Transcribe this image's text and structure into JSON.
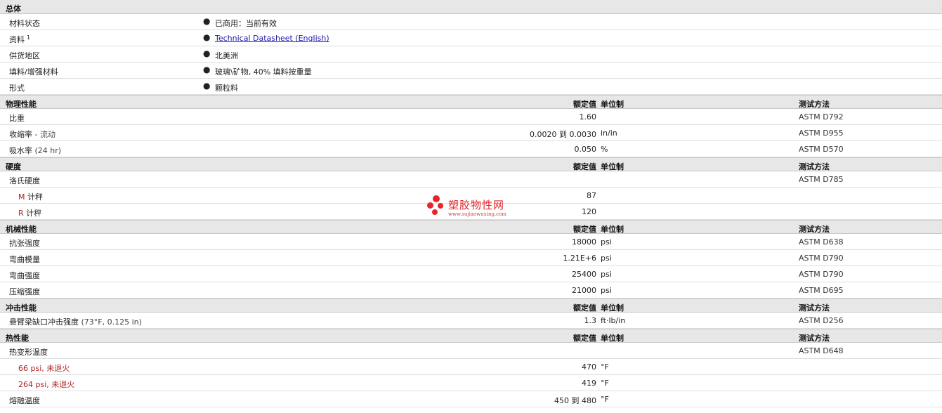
{
  "columns": {
    "value": "额定值",
    "unit": "单位制",
    "test": "测试方法"
  },
  "general": {
    "title": "总体",
    "rows": [
      {
        "label": "材料状态",
        "value": "已商用：当前有效"
      },
      {
        "label": "资料",
        "sup": "1",
        "value": "Technical Datasheet (English)"
      },
      {
        "label": "供货地区",
        "value": "北美洲"
      },
      {
        "label": "填料/增强材料",
        "value": "玻璃\\矿物, 40% 填料按重量"
      },
      {
        "label": "形式",
        "value": "颗粒料"
      }
    ]
  },
  "physical": {
    "title": "物理性能",
    "rows": [
      {
        "label": "比重",
        "cond": "",
        "value": "1.60",
        "unit": "",
        "test": "ASTM D792"
      },
      {
        "label": "收缩率",
        "cond": " - 流动",
        "value": "0.0020 到 0.0030",
        "unit": "in/in",
        "test": "ASTM D955"
      },
      {
        "label": "吸水率",
        "cond": " (24 hr)",
        "value": "0.050",
        "unit": "%",
        "test": "ASTM D570"
      }
    ]
  },
  "hardness": {
    "title": "硬度",
    "rows": [
      {
        "label": "洛氏硬度",
        "value": "",
        "unit": "",
        "test": "ASTM D785"
      }
    ],
    "subrows": [
      {
        "letter": "M",
        "label": " 计秤",
        "value": "87"
      },
      {
        "letter": "R",
        "label": " 计秤",
        "value": "120"
      }
    ]
  },
  "mechanical": {
    "title": "机械性能",
    "rows": [
      {
        "label": "抗张强度",
        "value": "18000",
        "unit": "psi",
        "test": "ASTM D638"
      },
      {
        "label": "弯曲模量",
        "value": "1.21E+6",
        "unit": "psi",
        "test": "ASTM D790"
      },
      {
        "label": "弯曲强度",
        "value": "25400",
        "unit": "psi",
        "test": "ASTM D790"
      },
      {
        "label": "压缩强度",
        "value": "21000",
        "unit": "psi",
        "test": "ASTM D695"
      }
    ]
  },
  "impact": {
    "title": "冲击性能",
    "rows": [
      {
        "label": "悬臂梁缺口冲击强度",
        "cond": " (73°F, 0.125 in)",
        "value": "1.3",
        "unit": "ft·lb/in",
        "test": "ASTM D256"
      }
    ]
  },
  "thermal": {
    "title": "热性能",
    "rows": [
      {
        "label": "热变形温度",
        "value": "",
        "unit": "",
        "test": "ASTM D648"
      },
      {
        "label": "66 psi, 未退火",
        "value": "470",
        "unit": "°F",
        "test": ""
      },
      {
        "label": "264 psi, 未退火",
        "value": "419",
        "unit": "°F",
        "test": ""
      },
      {
        "label": "熔融温度",
        "value": "450 到 480",
        "unit": "°F",
        "test": ""
      }
    ]
  },
  "watermark": {
    "name": "塑胶物性网",
    "url": "www.sujiaowuxing.com",
    "color": "#e8242a"
  },
  "bullet": "●"
}
